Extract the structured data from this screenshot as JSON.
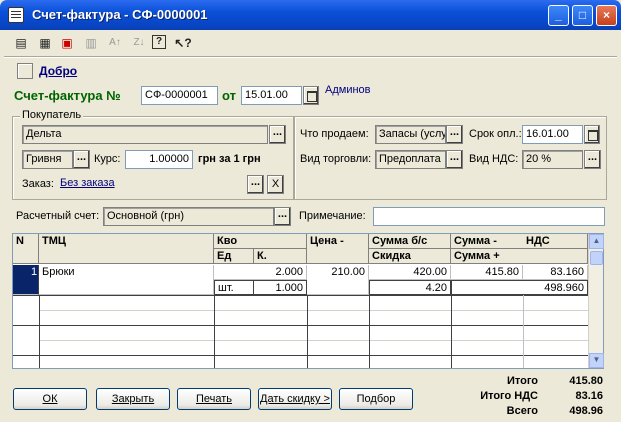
{
  "window": {
    "title": "Счет-фактура - СФ-0000001",
    "buttons": {
      "minimize": "_",
      "maximize": "□",
      "close": "×"
    }
  },
  "toolbar": {
    "icons": [
      "new-row-icon",
      "edit-row-icon",
      "delete-row-icon",
      "copy-icon",
      "sort-ascending-icon",
      "sort-descending-icon",
      "help-icon",
      "context-help-icon"
    ]
  },
  "header": {
    "approve_link": "Добро",
    "invoice_label": "Счет-фактура №",
    "invoice_number": "СФ-0000001",
    "from_label": "от",
    "date": "15.01.00",
    "author": "Админов"
  },
  "buyer_panel": {
    "legend": "Покупатель",
    "buyer": "Дельта",
    "currency": "Гривня",
    "rate_label": "Курс:",
    "rate": "1.00000",
    "rate_unit": "грн за 1 грн",
    "order_label": "Заказ:",
    "order_link": "Без заказа",
    "clear_button": "X"
  },
  "terms_panel": {
    "what_label": "Что продаем:",
    "what_value": "Запасы (услу",
    "due_label": "Срок опл.:",
    "due_value": "16.01.00",
    "trade_label": "Вид торговли:",
    "trade_value": "Предоплата",
    "vat_label": "Вид НДС:",
    "vat_value": "20 %"
  },
  "account": {
    "label": "Расчетный счет:",
    "value": "Основной (грн)",
    "note_label": "Примечание:",
    "note_value": ""
  },
  "table": {
    "headers": {
      "n": "N",
      "item": "ТМЦ",
      "qty": "Кво",
      "unit": "Ед",
      "k": "К.",
      "price": "Цена -",
      "sum_no_vat": "Сумма б/с",
      "discount": "Скидка",
      "sum_minus": "Сумма -",
      "vat": "НДС",
      "sum_plus": "Сумма +"
    },
    "rows": [
      {
        "n": "1",
        "item": "Брюки",
        "qty": "2.000",
        "unit": "шт.",
        "k": "1.000",
        "price": "210.00",
        "sum_no_vat": "420.00",
        "discount": "4.20",
        "sum_minus": "415.80",
        "vat": "83.160",
        "sum_plus": "498.960"
      }
    ]
  },
  "buttons": {
    "ok": "ОК",
    "close": "Закрыть",
    "print": "Печать",
    "discount": "Дать скидку >",
    "select": "Подбор"
  },
  "totals": {
    "total_label": "Итого",
    "total_value": "415.80",
    "vat_label": "Итого НДС",
    "vat_value": "83.16",
    "all_label": "Всего",
    "all_value": "498.96"
  }
}
